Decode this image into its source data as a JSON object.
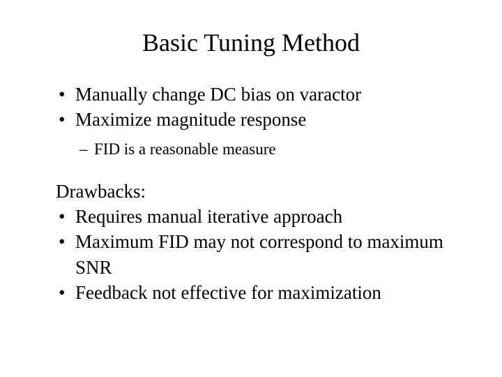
{
  "title": "Basic Tuning Method",
  "bullets1": {
    "item0": "Manually change DC bias on varactor",
    "item1": "Maximize magnitude response"
  },
  "subbullets": {
    "item0": "FID is a reasonable measure"
  },
  "section_label": "Drawbacks:",
  "bullets2": {
    "item0": "Requires manual iterative approach",
    "item1": "Maximum FID may not correspond to maximum SNR",
    "item2": "Feedback not effective for maximization"
  }
}
